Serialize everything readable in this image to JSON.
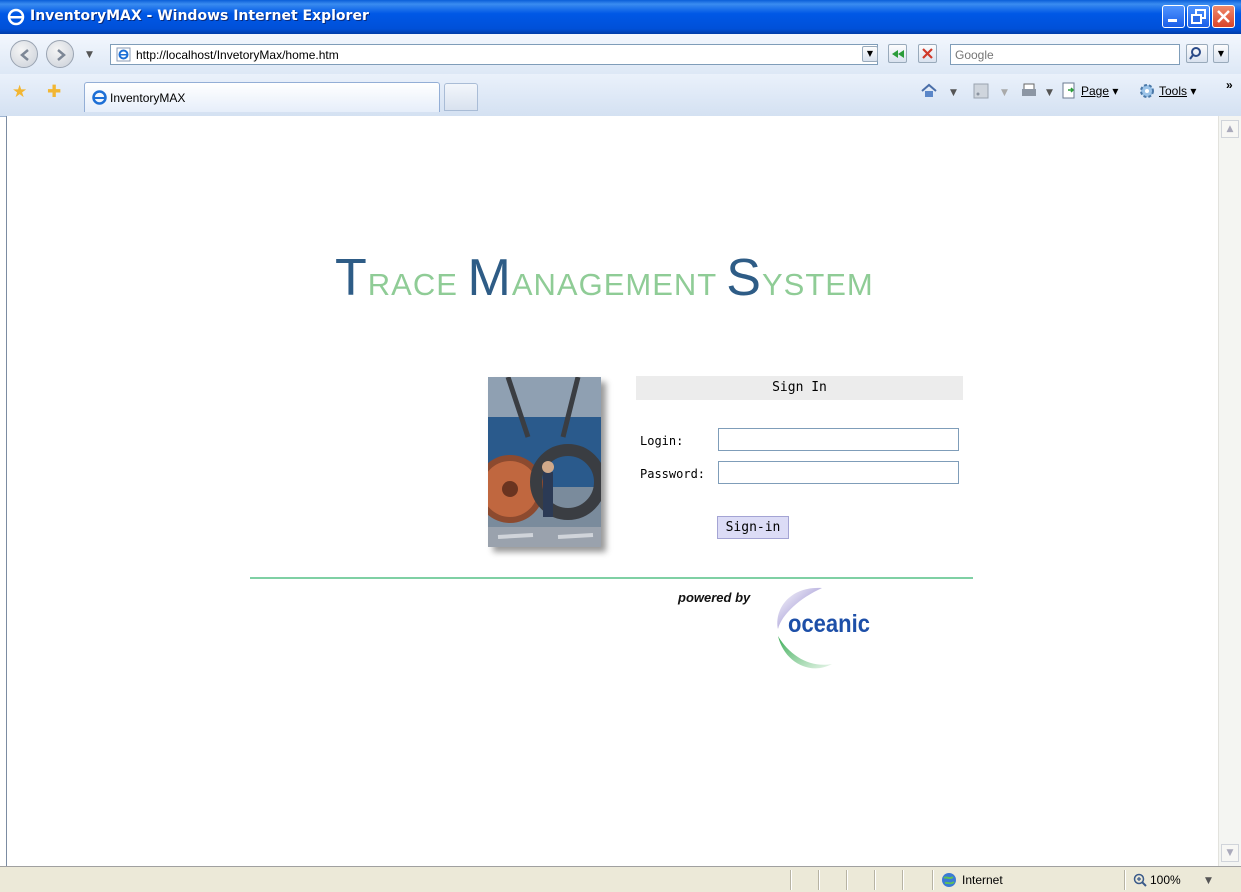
{
  "window": {
    "title": "InventoryMAX - Windows Internet Explorer"
  },
  "toolbar": {
    "url": "http://localhost/InvetoryMax/home.htm",
    "search_placeholder": "Google"
  },
  "tabs": [
    {
      "label": "InventoryMAX"
    }
  ],
  "commands": {
    "page_label": "Page",
    "tools_label": "Tools"
  },
  "page": {
    "brand": {
      "word1_cap": "T",
      "word1_rest": "RACE",
      "word2_cap": "M",
      "word2_rest": "ANAGEMENT",
      "word3_cap": "S",
      "word3_rest": "YSTEM"
    },
    "signin": {
      "heading": "Sign In",
      "login_label": "Login:",
      "password_label": "Password:",
      "login_value": "",
      "password_value": "",
      "button_label": "Sign-in"
    },
    "footer": {
      "powered_by": "powered by",
      "logo_text": "oceanic"
    }
  },
  "status": {
    "zone": "Internet",
    "zoom": "100%"
  },
  "colors": {
    "brand_cap": "#2e5c86",
    "brand_text": "#8fcc96",
    "divider": "#7fd0a4",
    "logo_text": "#1d4fa8"
  },
  "icons": [
    "ie-icon",
    "back-icon",
    "forward-icon",
    "refresh-icon",
    "stop-icon",
    "search-icon",
    "favorites-star-icon",
    "add-favorites-icon",
    "home-icon",
    "feeds-icon",
    "print-icon",
    "page-icon",
    "tools-gear-icon",
    "globe-icon",
    "zoom-icon"
  ]
}
